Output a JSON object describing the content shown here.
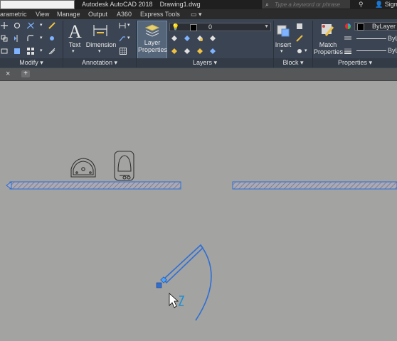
{
  "titlebar": {
    "title": "Autodesk AutoCAD 2018    Drawing1.dwg",
    "search_placeholder": "Type a keyword or phrase",
    "search_icon": "search-icon",
    "signin_label": "Sign In"
  },
  "menu_tabs": [
    "arametric",
    "View",
    "Manage",
    "Output",
    "A360",
    "Express Tools"
  ],
  "ribbon": {
    "modify_label": "Modify",
    "annotation_label": "Annotation",
    "layers_label": "Layers",
    "block_label": "Block",
    "properties_label": "Properties",
    "text_label": "Text",
    "dimension_label": "Dimension",
    "layer_properties_label": "Layer Properties",
    "insert_label": "Insert",
    "match_properties_label": "Match Properties",
    "layer_dropdown_value": "0",
    "color_dropdown_value": "ByLayer",
    "linetype_value": "ByL",
    "lineweight_value": "ByL"
  },
  "doc_tabs": {
    "close_glyph": "×",
    "add_glyph": "+"
  },
  "colors": {
    "canvas_bg": "#a3a3a1",
    "ribbon_bg": "#3b4452",
    "selection_blue": "#2e6fd6"
  }
}
